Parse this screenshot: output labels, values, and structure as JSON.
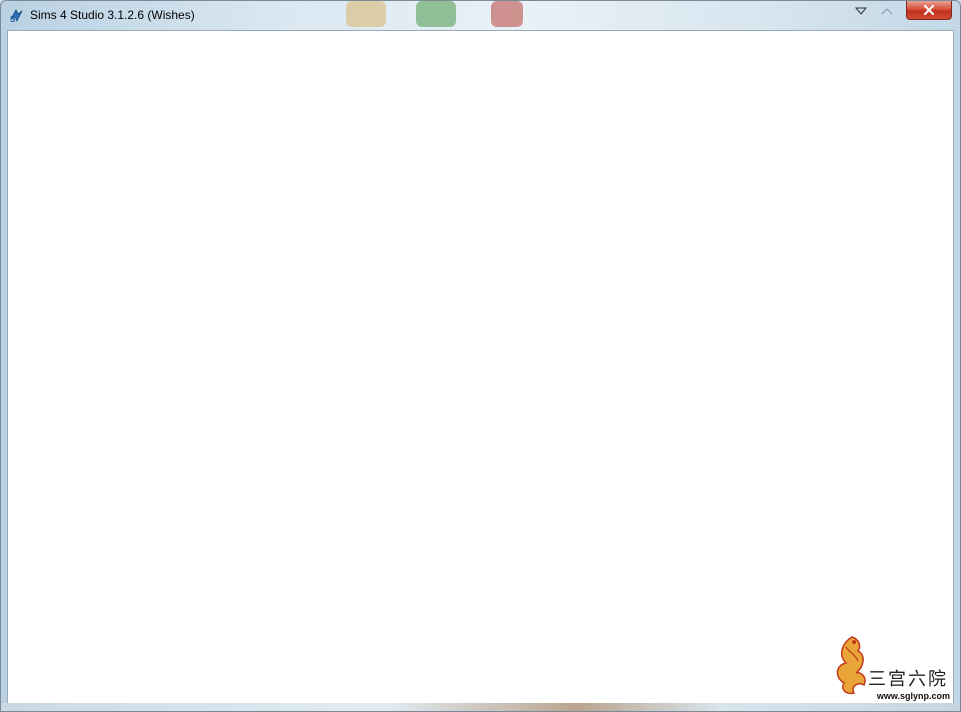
{
  "window": {
    "title": "Sims 4 Studio 3.1.2.6 (Wishes)",
    "app_icon": "sims4studio-icon",
    "caption_buttons": {
      "menu_icon": "dropdown-triangle-icon",
      "maximize_icon": "maximize-icon",
      "close_icon": "close-icon"
    },
    "colors": {
      "close_button": "#c1301c",
      "client_background": "#ffffff"
    }
  },
  "watermark": {
    "logo": "phoenix-logo",
    "chinese_text": "三宫六院",
    "url": "www.sglynp.com"
  }
}
